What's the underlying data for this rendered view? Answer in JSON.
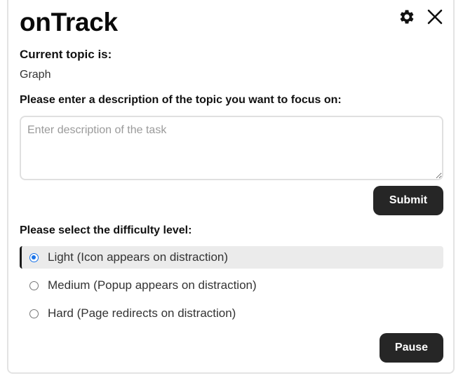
{
  "app": {
    "title": "onTrack"
  },
  "header": {
    "settings_icon": "gear-icon",
    "close_icon": "close-icon"
  },
  "topic": {
    "label": "Current topic is:",
    "value": "Graph"
  },
  "description": {
    "label": "Please enter a description of the topic you want to focus on:",
    "placeholder": "Enter description of the task",
    "value": ""
  },
  "buttons": {
    "submit": "Submit",
    "pause": "Pause"
  },
  "difficulty": {
    "label": "Please select the difficulty level:",
    "selected": "light",
    "options": [
      {
        "id": "light",
        "label": "Light (Icon appears on distraction)"
      },
      {
        "id": "medium",
        "label": "Medium (Popup appears on distraction)"
      },
      {
        "id": "hard",
        "label": "Hard (Page redirects on distraction)"
      }
    ]
  },
  "colors": {
    "button_bg": "#262626",
    "selected_row_bg": "#ebebeb",
    "radio_accent": "#1a73e8"
  }
}
